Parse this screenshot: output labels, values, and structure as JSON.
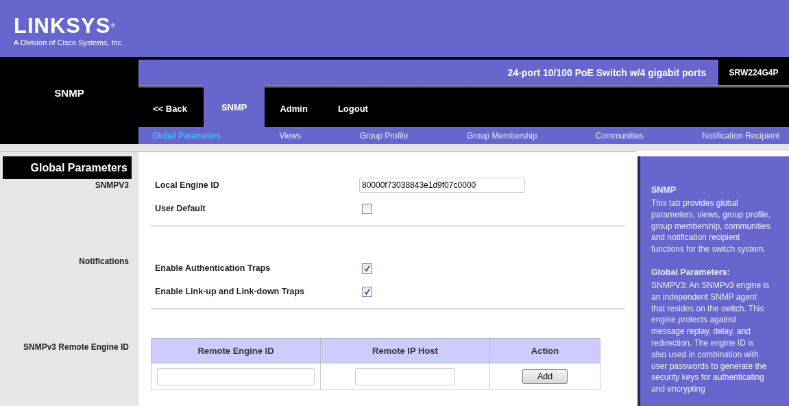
{
  "logo": {
    "name": "LINKSYS",
    "mark": "®",
    "tagline": "A Division of Cisco Systems, Inc."
  },
  "section_title": "SNMP",
  "product_description": "24-port 10/100 PoE Switch w/4 gigabit ports",
  "model": "SRW224G4P",
  "tabs": [
    {
      "label": "<< Back",
      "selected": false
    },
    {
      "label": "SNMP",
      "selected": true
    },
    {
      "label": "Admin",
      "selected": false
    },
    {
      "label": "Logout",
      "selected": false
    }
  ],
  "subtabs": [
    {
      "label": "Global Parameters",
      "selected": true
    },
    {
      "label": "Views",
      "selected": false
    },
    {
      "label": "Group Profile",
      "selected": false
    },
    {
      "label": "Group Membership",
      "selected": false
    },
    {
      "label": "Communities",
      "selected": false
    },
    {
      "label": "Notification Recipient",
      "selected": false
    }
  ],
  "page_title": "Global Parameters",
  "sections": [
    {
      "label": "SNMPV3",
      "fields": [
        {
          "kind": "text",
          "label": "Local Engine ID",
          "value": "80000f73038843e1d9f07c0000"
        },
        {
          "kind": "checkbox",
          "label": "User Default",
          "checked": false
        }
      ]
    },
    {
      "label": "Notifications",
      "fields": [
        {
          "kind": "checkbox",
          "label": "Enable Authentication Traps",
          "checked": true
        },
        {
          "kind": "checkbox",
          "label": "Enable Link-up and Link-down Traps",
          "checked": true
        }
      ]
    }
  ],
  "remote_engine": {
    "label": "SNMPv3 Remote Engine ID",
    "columns": [
      "Remote Engine ID",
      "Remote IP Host",
      "Action"
    ],
    "action_button": "Add"
  },
  "help": [
    {
      "title": "SNMP",
      "body": "This tab provides global parameters, views, group profile, group membership, communities and notification recipient functions for the switch system."
    },
    {
      "title": "Global Parameters:",
      "body": "SNMPV3: An SNMPv3 engine is an independent SNMP agent that resides on the switch. This engine protects against message replay, delay, and redirection. The engine ID is also used in combination with user passwords to generate the security keys for authenticating and encrypting"
    }
  ]
}
